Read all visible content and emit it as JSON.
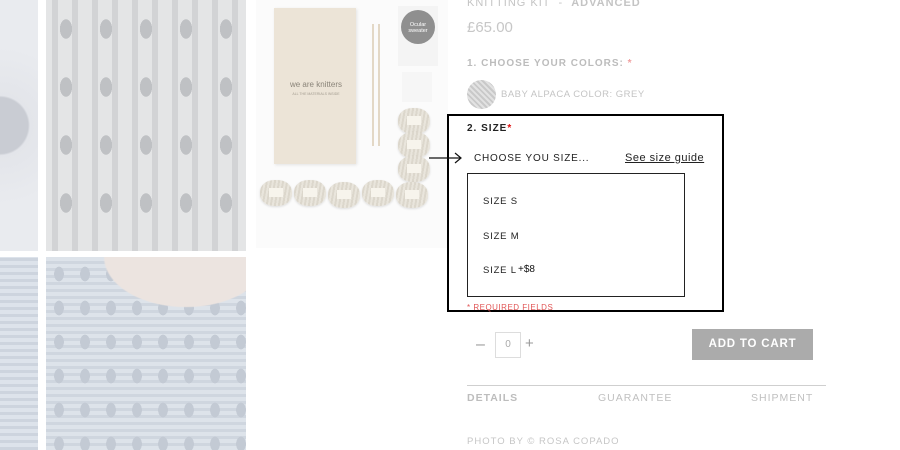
{
  "product": {
    "kit_label": "KNITTING KIT",
    "separator": "-",
    "level": "ADVANCED",
    "price": "£65.00"
  },
  "kit_image": {
    "box_title": "we are knitters",
    "box_subtitle": "ALL THE MATERIALS INSIDE",
    "badge_text": "Ocular sweater",
    "yarn_label": "THE WOOL"
  },
  "colors": {
    "title": "1. CHOOSE YOUR COLORS:",
    "required_mark": "*",
    "selected_label": "BABY ALPACA COLOR: GREY"
  },
  "size": {
    "title": "2. SIZE",
    "required_mark": "*",
    "placeholder": "CHOOSE YOU SIZE...",
    "guide_link": "See size guide",
    "options": [
      {
        "label": "SIZE S"
      },
      {
        "label": "SIZE M"
      },
      {
        "label": "SIZE L",
        "extra": "+$8"
      }
    ]
  },
  "required_note": "* REQUIRED FIELDS",
  "quantity": {
    "minus": "–",
    "value": "0",
    "plus": "+"
  },
  "cart_button": "ADD TO CART",
  "tabs": [
    "DETAILS",
    "GUARANTEE",
    "SHIPMENT"
  ],
  "photo_credit": "PHOTO BY © ROSA COPADO",
  "colors_palette": {
    "highlight_border": "#000000",
    "required": "#e01010",
    "cart_bg": "#ababab"
  }
}
